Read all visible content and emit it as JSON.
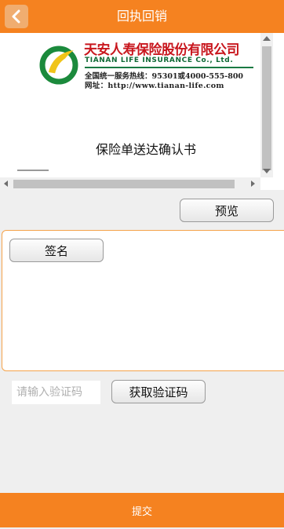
{
  "header": {
    "title": "回执回销",
    "back_icon": "chevron-left-icon"
  },
  "document": {
    "company_cn": "天安人寿保险股份有限公司",
    "company_en": "TIANAN LIFE INSURANCE Co., Ltd.",
    "hotline": "全国统一服务热线：95301或4000-555-800",
    "website": "网址：http://www.tianan-life.com",
    "title": "保险单送达确认书"
  },
  "actions": {
    "preview_label": "预览",
    "sign_label": "签名",
    "code_placeholder": "请输入验证码",
    "code_value": "",
    "get_code_label": "获取验证码",
    "submit_label": "提交"
  },
  "colors": {
    "accent": "#f58220",
    "company_red": "#c8161d",
    "company_green": "#0f6a36"
  }
}
